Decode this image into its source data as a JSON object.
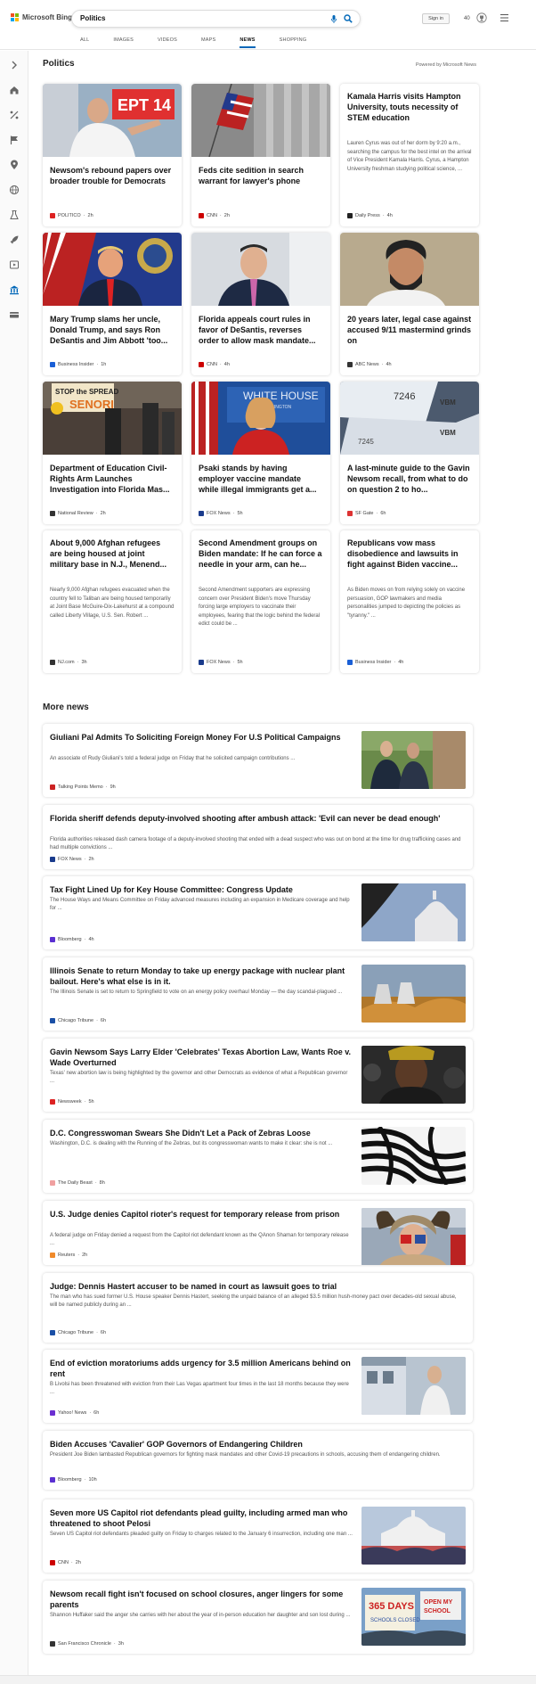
{
  "header": {
    "logo_text": "Microsoft Bing",
    "search_value": "Politics",
    "signin_label": "Sign in",
    "points": "40",
    "nav": [
      {
        "label": "ALL",
        "active": false
      },
      {
        "label": "IMAGES",
        "active": false
      },
      {
        "label": "VIDEOS",
        "active": false
      },
      {
        "label": "MAPS",
        "active": false
      },
      {
        "label": "NEWS",
        "active": true
      },
      {
        "label": "SHOPPING",
        "active": false
      }
    ]
  },
  "sidebar": {
    "icons": [
      "expand-icon",
      "home-icon",
      "sports-icon",
      "flag-icon",
      "location-icon",
      "globe-icon",
      "science-icon",
      "rocket-icon",
      "video-icon",
      "bank-icon",
      "money-icon"
    ]
  },
  "main": {
    "section_title": "Politics",
    "powered_by": "Powered by Microsoft News",
    "cards": [
      {
        "title": "Newsom's rebound papers over broader trouble for Democrats",
        "snippet": "",
        "source": "POLITICO",
        "time": "2h",
        "image": "newsom",
        "src_color": "#d22",
        "has_image": true
      },
      {
        "title": "Feds cite sedition in search warrant for lawyer's phone",
        "snippet": "",
        "source": "CNN",
        "time": "2h",
        "image": "doj",
        "src_color": "#c00",
        "has_image": true
      },
      {
        "title": "Kamala Harris visits Hampton University, touts necessity of STEM education",
        "snippet": "Lauren Cyrus was out of her dorm by 9:20 a.m., searching the campus for the best intel on the arrival of Vice President Kamala Harris. Cyrus, a Hampton University freshman studying political science, ...",
        "source": "Daily Press",
        "time": "4h",
        "image": "",
        "src_color": "#222",
        "has_image": false
      },
      {
        "title": "Mary Trump slams her uncle, Donald Trump, and says Ron DeSantis and Jim Abbott 'too...",
        "snippet": "",
        "source": "Business Insider",
        "time": "1h",
        "image": "trump",
        "src_color": "#1a5fd6",
        "has_image": true
      },
      {
        "title": "Florida appeals court rules in favor of DeSantis, reverses order to allow mask mandate...",
        "snippet": "",
        "source": "CNN",
        "time": "4h",
        "image": "desantis",
        "src_color": "#c00",
        "has_image": true
      },
      {
        "title": "20 years later, legal case against accused 9/11 mastermind grinds on",
        "snippet": "",
        "source": "ABC News",
        "time": "4h",
        "image": "ksm",
        "src_color": "#333",
        "has_image": true
      },
      {
        "title": "Department of Education Civil-Rights Arm Launches Investigation into Florida Mas...",
        "snippet": "",
        "source": "National Review",
        "time": "2h",
        "image": "protest",
        "src_color": "#333",
        "has_image": true
      },
      {
        "title": "Psaki stands by having employer vaccine mandate while illegal immigrants get a...",
        "snippet": "",
        "source": "FOX News",
        "time": "5h",
        "image": "psaki",
        "src_color": "#1a3b8c",
        "has_image": true
      },
      {
        "title": "A last-minute guide to the Gavin Newsom recall, from what to do on question 2 to ho...",
        "snippet": "",
        "source": "SF Gate",
        "time": "6h",
        "image": "ballot",
        "src_color": "#d33",
        "has_image": true
      },
      {
        "title": "About 9,000 Afghan refugees are being housed at joint military base in N.J., Menend...",
        "snippet": "Nearly 9,000 Afghan refugees evacuated when the country fell to Taliban are being housed temporarily at Joint Base McGuire-Dix-Lakehurst at a compound called Liberty Village, U.S. Sen. Robert ...",
        "source": "NJ.com",
        "time": "3h",
        "image": "",
        "src_color": "#333",
        "has_image": false
      },
      {
        "title": "Second Amendment groups on Biden mandate: If he can force a needle in your arm, can he...",
        "snippet": "Second Amendment supporters are expressing concern over President Biden's move Thursday forcing large employers to vaccinate their employees, fearing that the logic behind the federal edict could be ...",
        "source": "FOX News",
        "time": "5h",
        "image": "",
        "src_color": "#1a3b8c",
        "has_image": false
      },
      {
        "title": "Republicans vow mass disobedience and lawsuits in fight against Biden vaccine...",
        "snippet": "As Biden moves on from relying solely on vaccine persuasion, GOP lawmakers and media personalities jumped to depicting the policies as \"tyranny.\" ...",
        "source": "Business Insider",
        "time": "4h",
        "image": "",
        "src_color": "#1a5fd6",
        "has_image": false
      }
    ]
  },
  "more_news": {
    "title": "More news",
    "items": [
      {
        "title": "Giuliani Pal Admits To Soliciting Foreign Money For U.S Political Campaigns",
        "snippet": "An associate of Rudy Giuliani's told a federal judge on Friday that he solicited campaign contributions ...",
        "source": "Talking Points Memo",
        "time": "9h",
        "image": "giuliani",
        "src_color": "#c22"
      },
      {
        "title": "Florida sheriff defends deputy-involved shooting after ambush attack: 'Evil can never be dead enough'",
        "snippet": "Florida authorities released dash camera footage of a deputy-involved shooting that ended with a dead suspect who was out on bond at the time for drug trafficking cases and had multiple convictions ...",
        "source": "FOX News",
        "time": "2h",
        "image": "",
        "src_color": "#1a3b8c"
      },
      {
        "title": "Tax Fight Lined Up for Key House Committee: Congress Update",
        "snippet": "The House Ways and Means Committee on Friday advanced measures including an expansion in Medicare coverage and help for ...",
        "source": "Bloomberg",
        "time": "4h",
        "image": "capitol_dark",
        "src_color": "#5a2fd1"
      },
      {
        "title": "Illinois Senate to return Monday to take up energy package with nuclear plant bailout. Here's what else is in it.",
        "snippet": "The Illinois Senate is set to return to Springfield to vote on an energy policy overhaul Monday — the day scandal-plagued ...",
        "source": "Chicago Tribune",
        "time": "6h",
        "image": "nuclear",
        "src_color": "#1a4fa6"
      },
      {
        "title": "Gavin Newsom Says Larry Elder 'Celebrates' Texas Abortion Law, Wants Roe v. Wade Overturned",
        "snippet": "Texas' new abortion law is being highlighted by the governor and other Democrats as evidence of what a Republican governor ...",
        "source": "Newsweek",
        "time": "5h",
        "image": "elder",
        "src_color": "#d22"
      },
      {
        "title": "D.C. Congresswoman Swears She Didn't Let a Pack of Zebras Loose",
        "snippet": "Washington, D.C. is dealing with the Running of the Zebras, but its congresswoman wants to make it clear: she is not ...",
        "source": "The Daily Beast",
        "time": "8h",
        "image": "zebra",
        "src_color": "#f0a0a0"
      },
      {
        "title": "U.S. Judge denies Capitol rioter's request for temporary release from prison",
        "snippet": "A federal judge on Friday denied a request from the Capitol riot defendant known as the QAnon Shaman for temporary release ...",
        "source": "Reuters",
        "time": "2h",
        "image": "shaman",
        "src_color": "#f08a2a"
      },
      {
        "title": "Judge: Dennis Hastert accuser to be named in court as lawsuit goes to trial",
        "snippet": "The man who has sued former U.S. House speaker Dennis Hastert, seeking the unpaid balance of an alleged $3.5 million hush-money pact over decades-old sexual abuse, will be named publicly during an ...",
        "source": "Chicago Tribune",
        "time": "6h",
        "image": "",
        "src_color": "#1a4fa6"
      },
      {
        "title": "End of eviction moratoriums adds urgency for 3.5 million Americans behind on rent",
        "snippet": "B Livolsi has been threatened with eviction from their Las Vegas apartment four times in the last 18 months because they were ...",
        "source": "Yahoo! News",
        "time": "6h",
        "image": "eviction",
        "src_color": "#6b2fd1"
      },
      {
        "title": "Biden Accuses 'Cavalier' GOP Governors of Endangering Children",
        "snippet": "President Joe Biden lambasted Republican governors for fighting mask mandates and other Covid-19 precautions in schools, accusing them of endangering children.",
        "source": "Bloomberg",
        "time": "10h",
        "image": "",
        "src_color": "#5a2fd1"
      },
      {
        "title": "Seven more US Capitol riot defendants plead guilty, including armed man who threatened to shoot Pelosi",
        "snippet": "Seven US Capitol riot defendants pleaded guilty on Friday to charges related to the January 6 insurrection, including one man ...",
        "source": "CNN",
        "time": "2h",
        "image": "capitol_crowd",
        "src_color": "#c00"
      },
      {
        "title": "Newsom recall fight isn't focused on school closures, anger lingers for some parents",
        "snippet": "Shannon Huffaker said the anger she carries with her about the year of in-person education her daughter and son lost during ...",
        "source": "San Francisco Chronicle",
        "time": "3h",
        "image": "school_protest",
        "src_color": "#333"
      }
    ]
  }
}
